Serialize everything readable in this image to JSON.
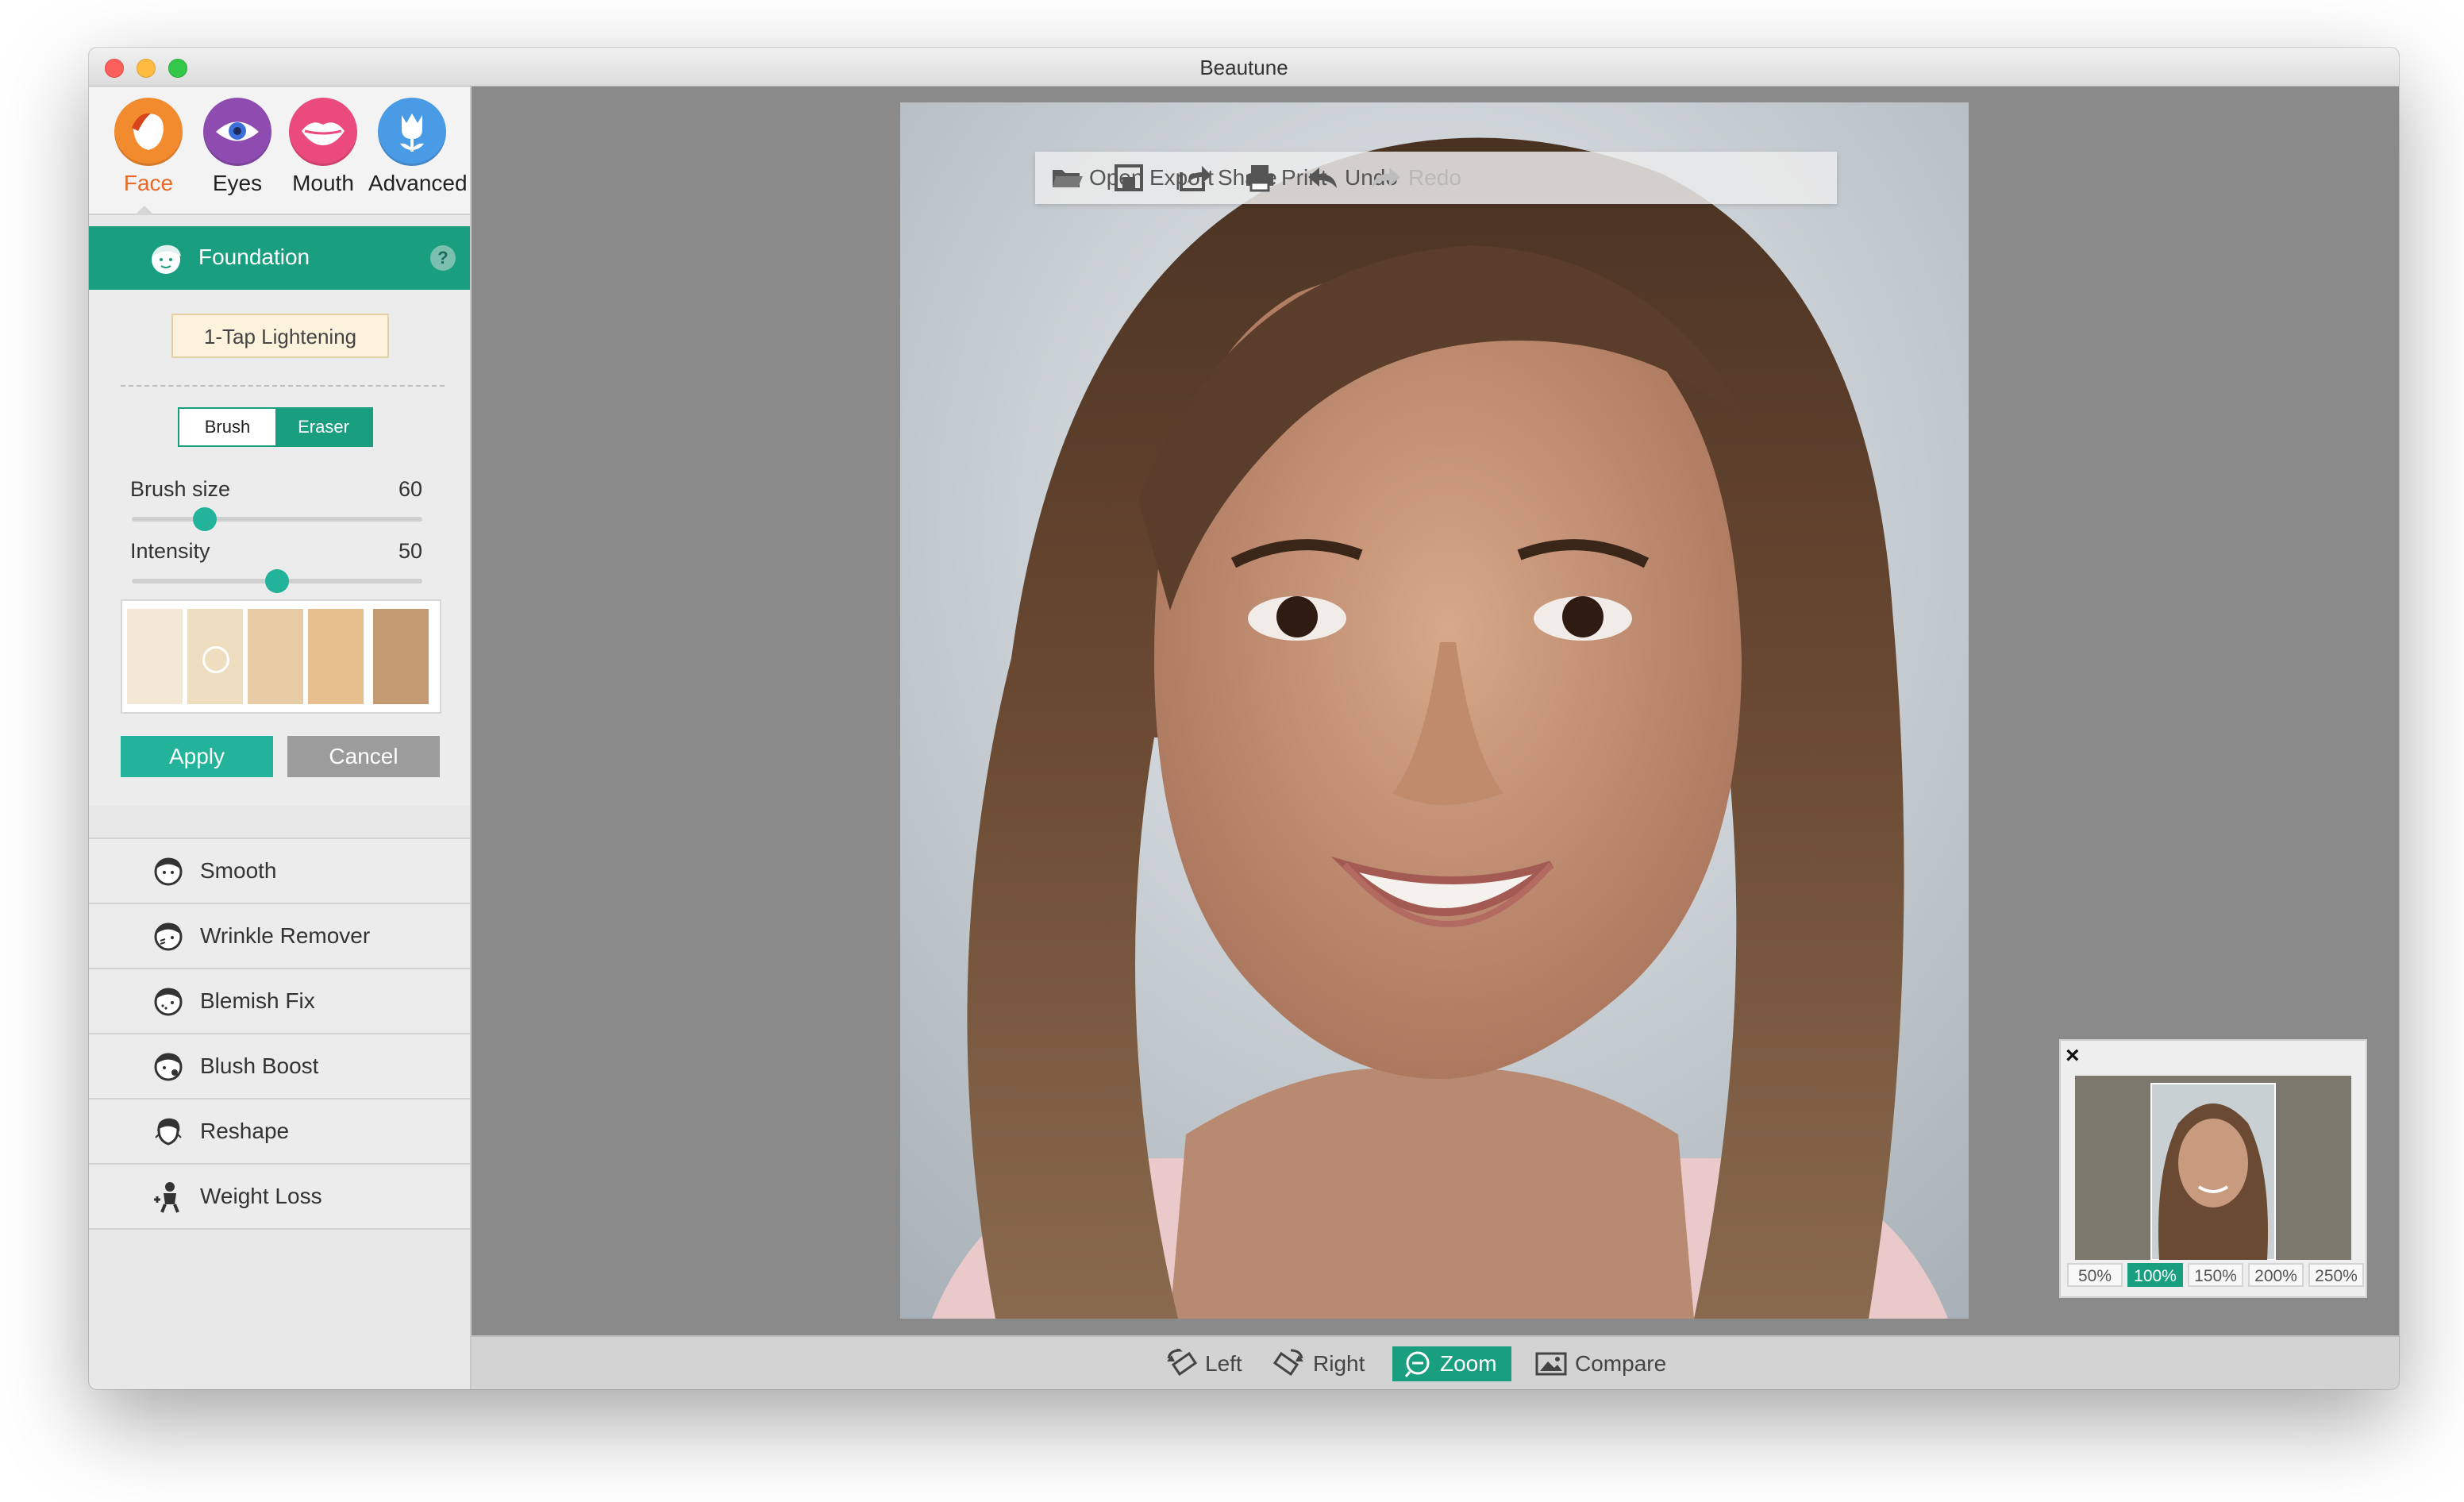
{
  "window": {
    "title": "Beautune"
  },
  "categories": [
    {
      "label": "Face",
      "icon": "face-icon",
      "color": "#f28a2e",
      "active": true
    },
    {
      "label": "Eyes",
      "icon": "eye-icon",
      "color": "#8e4bb0"
    },
    {
      "label": "Mouth",
      "icon": "lips-icon",
      "color": "#ea4a7c"
    },
    {
      "label": "Advanced",
      "icon": "tulip-icon",
      "color": "#4a9be6"
    }
  ],
  "active_tool": {
    "label": "Foundation",
    "icon": "foundation-face-icon",
    "help": "?"
  },
  "foundation_panel": {
    "one_tap_label": "1-Tap Lightening",
    "mode": {
      "brush": "Brush",
      "eraser": "Eraser",
      "selected": "Brush"
    },
    "brush_size": {
      "label": "Brush size",
      "value": "60",
      "fraction": 0.25
    },
    "intensity": {
      "label": "Intensity",
      "value": "50",
      "fraction": 0.5
    },
    "swatches": [
      "#f3e8d6",
      "#efddc0",
      "#e6cba4",
      "#e7bf8e",
      "#c39a72"
    ],
    "selected_swatch": 1,
    "apply_label": "Apply",
    "cancel_label": "Cancel"
  },
  "tools": [
    {
      "label": "Smooth",
      "icon": "smooth-face-icon"
    },
    {
      "label": "Wrinkle Remover",
      "icon": "wrinkle-face-icon"
    },
    {
      "label": "Blemish Fix",
      "icon": "blemish-face-icon"
    },
    {
      "label": "Blush Boost",
      "icon": "blush-face-icon"
    },
    {
      "label": "Reshape",
      "icon": "reshape-face-icon"
    },
    {
      "label": "Weight Loss",
      "icon": "weight-loss-icon"
    }
  ],
  "toolbar": {
    "open": "Open",
    "export": "Export",
    "share": "Share",
    "print": "Print",
    "undo": "Undo",
    "redo": "Redo"
  },
  "navigator": {
    "close": "×",
    "zoom_levels": [
      "50%",
      "100%",
      "150%",
      "200%",
      "250%"
    ],
    "selected_zoom": "100%"
  },
  "bottom_bar": {
    "left": "Left",
    "right": "Right",
    "zoom": "Zoom",
    "compare": "Compare",
    "selected": "Zoom"
  },
  "accent_color": "#1a9e80"
}
